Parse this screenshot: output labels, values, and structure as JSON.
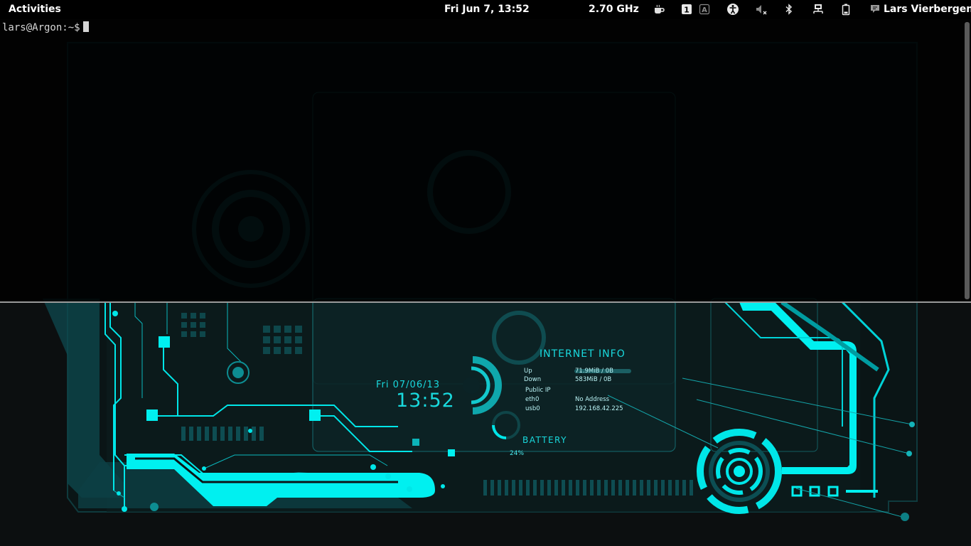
{
  "topbar": {
    "activities": "Activities",
    "clock": "Fri Jun  7, 13:52",
    "cpu_freq": "2.70 GHz",
    "user_name": "Lars Vierbergen",
    "tray_icons": [
      "coffee-cup-icon",
      "workspace-1-icon",
      "keyboard-layout-a-icon",
      "accessibility-icon",
      "volume-muted-icon",
      "bluetooth-icon",
      "network-wired-icon",
      "battery-icon",
      "chat-status-icon"
    ],
    "workspace_number": "1",
    "keyboard_layout": "A"
  },
  "terminal": {
    "prompt": "lars@Argon:~$"
  },
  "desktop_widgets": {
    "clock_date": "Fri 07/06/13",
    "clock_time": "13:52",
    "internet_info": {
      "title": "INTERNET INFO",
      "up_label": "Up",
      "up_value": "71.9MiB / 0B",
      "down_label": "Down",
      "down_value": "583MiB / 0B",
      "public_ip_label": "Public IP",
      "eth0_label": "eth0",
      "eth0_value": "No Address",
      "usb0_label": "usb0",
      "usb0_value": "192.168.42.225"
    },
    "battery": {
      "title": "BATTERY",
      "percent": "24%",
      "level": 0.24
    }
  },
  "colors": {
    "accent": "#00f0f0",
    "accent_dim": "#0a6f73",
    "background": "#0b0d0e",
    "topbar": "#000000"
  }
}
